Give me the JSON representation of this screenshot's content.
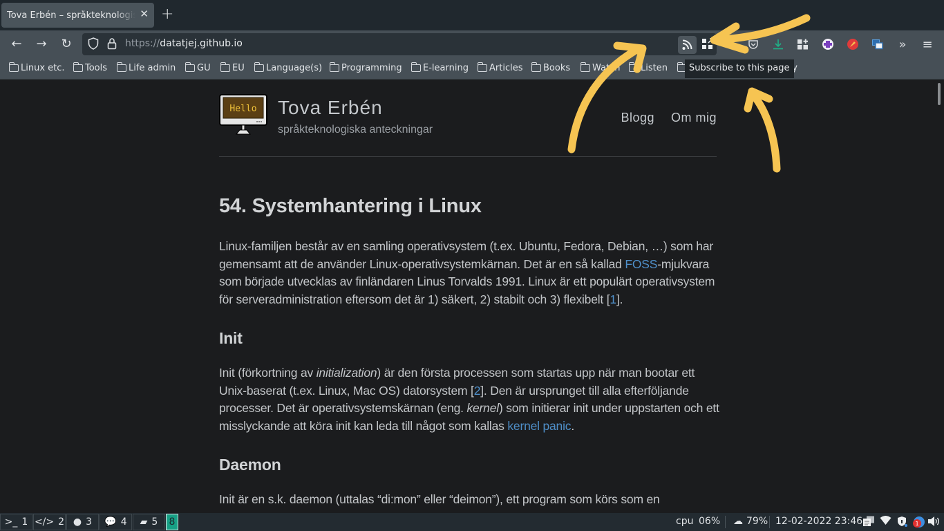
{
  "browser": {
    "tab": {
      "title": "Tova Erbén – språkteknologiska anteckningar",
      "close_icon": "close-icon"
    },
    "new_tab_icon": "plus-icon",
    "nav": {
      "back_icon": "arrow-left-icon",
      "forward_icon": "arrow-right-icon",
      "reload_icon": "reload-icon"
    },
    "url": {
      "scheme": "https://",
      "host": "datatjej.github.io"
    },
    "toolbar_icons": [
      "rss-icon",
      "qr-code-icon",
      "pocket-icon",
      "download-icon",
      "extensions-icon",
      "privacy-badger-icon",
      "highlighter-icon",
      "multi-window-icon",
      "overflow-chevrons-icon",
      "hamburger-menu-icon"
    ],
    "bookmarks": [
      "Linux etc.",
      "Tools",
      "Life admin",
      "GU",
      "EU",
      "Language(s)",
      "Programming",
      "E-learning",
      "Articles",
      "Books",
      "Watch",
      "Listen",
      "Sy",
      "hy"
    ],
    "tooltip": "Subscribe to this page"
  },
  "site": {
    "logo_text": "Hello",
    "title": "Tova Erbén",
    "subtitle": "språkteknologiska anteckningar",
    "nav": [
      "Blogg",
      "Om mig"
    ]
  },
  "article": {
    "title": "54. Systemhantering i Linux",
    "intro": {
      "part1": "Linux-familjen består av en samling operativsystem (t.ex. Ubuntu, Fedora, Debian, …) som har gemensamt att de använder Linux-operativsystemkärnan. Det är en så kallad ",
      "link": "FOSS",
      "part2": "-mjukvara som började utvecklas av finländaren Linus Torvalds 1991. Linux är ett populärt operativsystem för serveradministration eftersom det är 1) säkert, 2) stabilt och 3) flexibelt [",
      "ref": "1",
      "part3": "]."
    },
    "sections": [
      {
        "heading": "Init",
        "p1": "Init (förkortning av ",
        "em1": "initialization",
        "p2": ") är den första processen som startas upp när man bootar ett Unix-baserat (t.ex. Linux, Mac OS) datorsystem [",
        "ref": "2",
        "p3": "]. Den är ursprunget till alla efterföljande processer. Det är operativsystemskärnan (eng. ",
        "em2": "kernel",
        "p4": ") som initierar init under uppstarten och ett misslyckande att köra init kan leda till något som kallas ",
        "link": "kernel panic",
        "p5": "."
      },
      {
        "heading": "Daemon",
        "text": "Init är en s.k. daemon (uttalas “di:mon” eller “deimon”), ett program som körs som en"
      }
    ]
  },
  "taskbar": {
    "workspaces": [
      {
        "icon": ">_",
        "num": "1"
      },
      {
        "icon": "</>",
        "num": "2"
      },
      {
        "icon": "globe",
        "num": "3"
      },
      {
        "icon": "chat",
        "num": "4"
      },
      {
        "icon": "book",
        "num": "5"
      }
    ],
    "active_workspace": "8",
    "cpu_label": "cpu",
    "cpu_value": "06%",
    "disk_value": "79%",
    "datetime": "12-02-2022 23:46",
    "notification_count": "1",
    "tray_icons": [
      "clipboard-icon",
      "wifi-icon",
      "shield-icon",
      "notification-icon",
      "volume-icon"
    ]
  },
  "colors": {
    "accent": "#16a085",
    "link": "#4f8fc9",
    "annotation": "#f6c452"
  }
}
